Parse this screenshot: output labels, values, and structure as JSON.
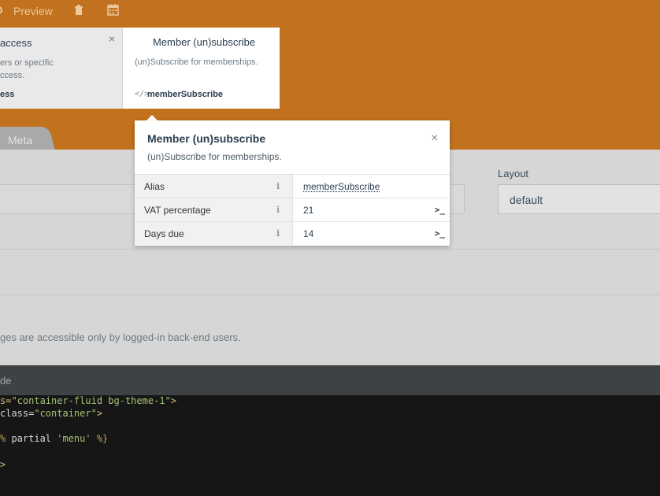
{
  "toolbar": {
    "preview_label": "Preview",
    "icons": [
      "gear-icon",
      "trash-icon",
      "calendar-icon"
    ]
  },
  "components": {
    "left": {
      "title": "access",
      "desc_line1": "ers or specific",
      "desc_line2": "ccess.",
      "alias": "ess"
    },
    "right": {
      "title": "Member (un)subscribe",
      "desc": "(un)Subscribe for memberships.",
      "alias": "memberSubscribe"
    }
  },
  "tabs": {
    "meta_label": "Meta"
  },
  "form": {
    "layout_label": "Layout",
    "layout_value": "default",
    "hint": "ges are accessible only by logged-in back-end users."
  },
  "popover": {
    "title": "Member (un)subscribe",
    "desc": "(un)Subscribe for memberships.",
    "rows": [
      {
        "name": "Alias",
        "value": "memberSubscribe"
      },
      {
        "name": "VAT percentage",
        "value": "21"
      },
      {
        "name": "Days due",
        "value": "14"
      }
    ]
  },
  "code": {
    "header": "de",
    "line1_attr": "s=",
    "line1_str": "\"container-fluid bg-theme-1\"",
    "line1_end": ">",
    "line2_attr": "class=",
    "line2_str": "\"container\"",
    "line2_end": ">",
    "line3_pct1": "% ",
    "line3_kw": "partial ",
    "line3_str": "'menu'",
    "line3_pct2": " %}",
    "line4": ">"
  },
  "colors": {
    "header_orange": "#c2721f",
    "code_bg": "#161616"
  }
}
